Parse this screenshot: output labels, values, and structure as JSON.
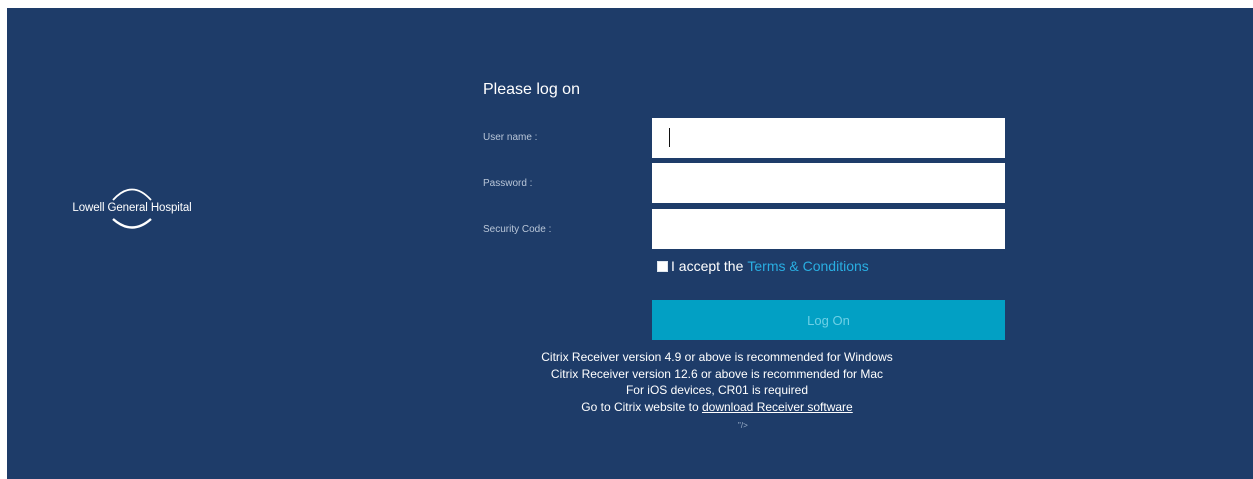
{
  "logo": {
    "text": "Lowell General Hospital",
    "icon": "arc-logo-icon"
  },
  "form": {
    "title": "Please log on",
    "username_label": "User name :",
    "password_label": "Password :",
    "security_label": "Security Code :",
    "username_value": "",
    "password_value": "",
    "security_value": "",
    "terms_prefix": "I accept the",
    "terms_link": "Terms & Conditions",
    "terms_checked": false,
    "logon_label": "Log On"
  },
  "info": {
    "line1": "Citrix Receiver version 4.9 or above is recommended for Windows",
    "line2": "Citrix Receiver version 12.6 or above is recommended for Mac",
    "line3": "For iOS devices, CR01 is required",
    "line4_prefix": "Go to Citrix website to",
    "line4_link": "download Receiver software",
    "stray": "\"/>"
  },
  "colors": {
    "background": "#1e3c69",
    "button": "#02a0c4",
    "link": "#29aee2"
  }
}
